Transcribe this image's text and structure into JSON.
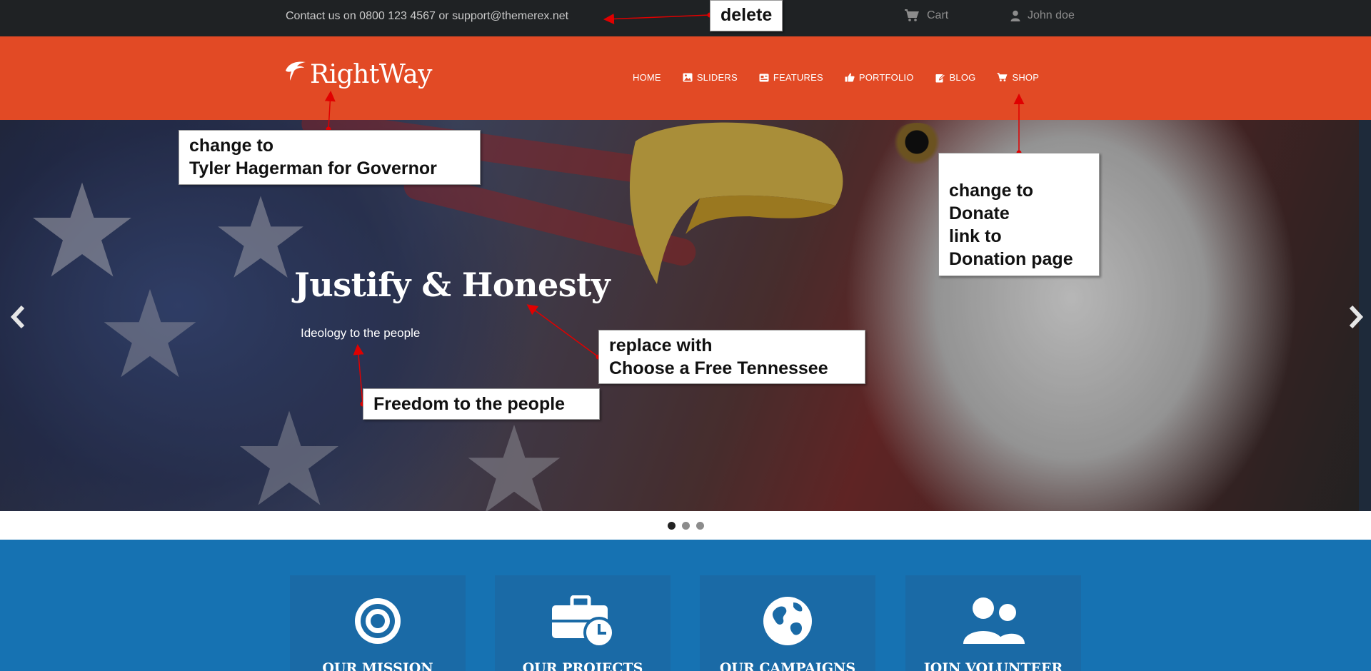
{
  "topbar": {
    "contact_text": "Contact us on 0800 123 4567 or support@themerex.net",
    "cart_label": "Cart",
    "cart_icon": "cart-icon",
    "user_label": "John doe",
    "user_icon": "user-icon"
  },
  "header": {
    "logo_text": "RightWay",
    "logo_icon": "eagle-icon",
    "background_color": "#e24a25",
    "nav": [
      {
        "label": "HOME",
        "icon": ""
      },
      {
        "label": "SLIDERS",
        "icon": "image-icon"
      },
      {
        "label": "FEATURES",
        "icon": "card-icon"
      },
      {
        "label": "PORTFOLIO",
        "icon": "thumbs-up-icon"
      },
      {
        "label": "BLOG",
        "icon": "edit-icon"
      },
      {
        "label": "SHOP",
        "icon": "cart-icon"
      }
    ]
  },
  "hero": {
    "title": "Justify & Honesty",
    "subtitle": "Ideology to the people",
    "prev_icon": "chevron-left-icon",
    "next_icon": "chevron-right-icon"
  },
  "slider_dots": {
    "count": 3,
    "active_index": 0
  },
  "annotations": {
    "delete": [
      "delete"
    ],
    "logo": [
      "change to",
      "Tyler Hagerman for Governor"
    ],
    "shop": [
      "change to",
      "Donate",
      "link to",
      "Donation page"
    ],
    "title": [
      "replace with",
      "Choose a Free Tennessee"
    ],
    "subtitle": [
      "Freedom to the people"
    ],
    "arrow_color": "#e00000"
  },
  "features": {
    "background_color": "#1672b2",
    "cards": [
      {
        "label": "OUR MISSION",
        "icon": "target-icon"
      },
      {
        "label": "OUR PROJECTS",
        "icon": "briefcase-clock-icon"
      },
      {
        "label": "OUR CAMPAIGNS",
        "icon": "globe-icon"
      },
      {
        "label": "JOIN VOLUNTEER",
        "icon": "users-icon"
      }
    ]
  }
}
